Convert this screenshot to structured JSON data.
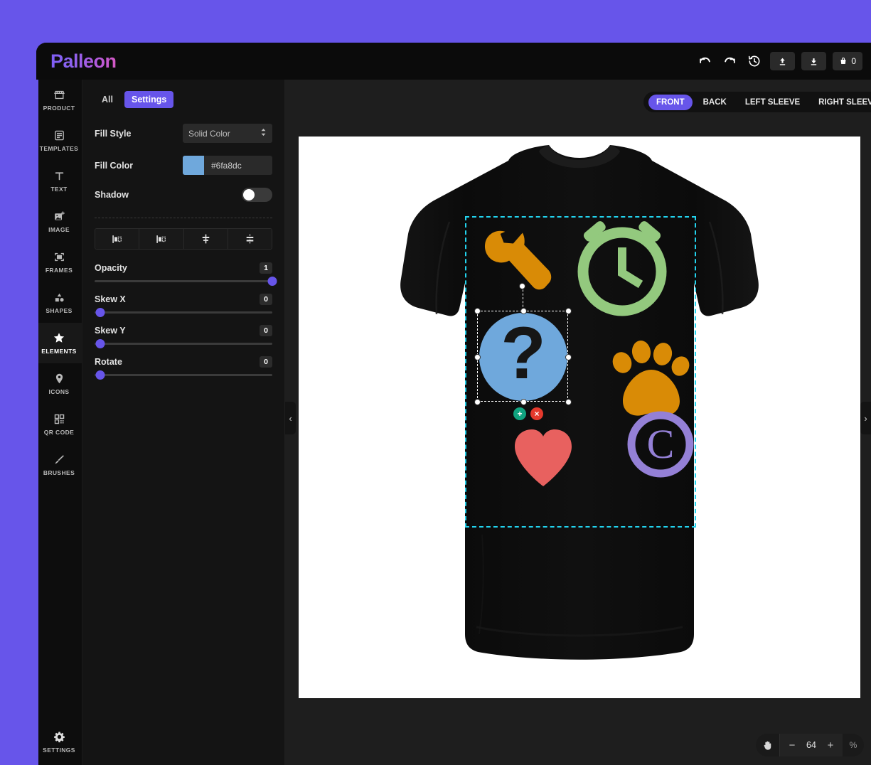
{
  "app": {
    "name": "Palleon"
  },
  "topbar": {
    "undo": "undo-icon",
    "redo": "redo-icon",
    "history": "history-icon",
    "upload": "upload-icon",
    "download": "download-icon",
    "cart_count": "0"
  },
  "sidebar": {
    "items": [
      {
        "label": "PRODUCT",
        "icon": "store-icon",
        "active": false
      },
      {
        "label": "TEMPLATES",
        "icon": "template-icon",
        "active": false
      },
      {
        "label": "TEXT",
        "icon": "text-icon",
        "active": false
      },
      {
        "label": "IMAGE",
        "icon": "image-icon",
        "active": false
      },
      {
        "label": "FRAMES",
        "icon": "frame-icon",
        "active": false
      },
      {
        "label": "SHAPES",
        "icon": "shapes-icon",
        "active": false
      },
      {
        "label": "ELEMENTS",
        "icon": "star-icon",
        "active": true
      },
      {
        "label": "ICONS",
        "icon": "pin-icon",
        "active": false
      },
      {
        "label": "QR CODE",
        "icon": "qrcode-icon",
        "active": false
      },
      {
        "label": "BRUSHES",
        "icon": "brush-icon",
        "active": false
      }
    ],
    "settings": {
      "label": "SETTINGS",
      "icon": "gear-icon"
    }
  },
  "panel": {
    "tabs": [
      {
        "label": "All",
        "active": false
      },
      {
        "label": "Settings",
        "active": true
      }
    ],
    "fill_style": {
      "label": "Fill Style",
      "value": "Solid Color"
    },
    "fill_color": {
      "label": "Fill Color",
      "value": "#6fa8dc",
      "swatch": "#6fa8dc"
    },
    "shadow": {
      "label": "Shadow",
      "enabled": "off"
    },
    "align_buttons": [
      "align-horizontal-left-icon",
      "align-horizontal-right-icon",
      "align-vertical-center-icon",
      "distribute-vertical-icon"
    ],
    "sliders": [
      {
        "label": "Opacity",
        "value": "1",
        "pct": 100
      },
      {
        "label": "Skew X",
        "value": "0",
        "pct": 3
      },
      {
        "label": "Skew Y",
        "value": "0",
        "pct": 3
      },
      {
        "label": "Rotate",
        "value": "0",
        "pct": 3
      }
    ]
  },
  "collapse": {
    "left": "‹",
    "right": "›"
  },
  "workspace": {
    "view_tabs": [
      {
        "label": "FRONT",
        "active": true
      },
      {
        "label": "BACK",
        "active": false
      },
      {
        "label": "LEFT SLEEVE",
        "active": false
      },
      {
        "label": "RIGHT SLEEVE",
        "active": false
      }
    ],
    "zoom": {
      "hand": "pan-hand-icon",
      "minus": "−",
      "value": "64",
      "plus": "+",
      "unit": "%"
    },
    "selection": {
      "add_label": "+",
      "delete_label": "×",
      "add_color": "#10a37f",
      "delete_color": "#e5392c"
    },
    "design_elements": [
      {
        "name": "wrench",
        "color": "#d98b06"
      },
      {
        "name": "clock",
        "color": "#93c97e"
      },
      {
        "name": "question",
        "color": "#6fa8dc"
      },
      {
        "name": "paw",
        "color": "#d98b06"
      },
      {
        "name": "heart",
        "color": "#e8615f"
      },
      {
        "name": "copyright",
        "color": "#9480d6"
      }
    ]
  }
}
